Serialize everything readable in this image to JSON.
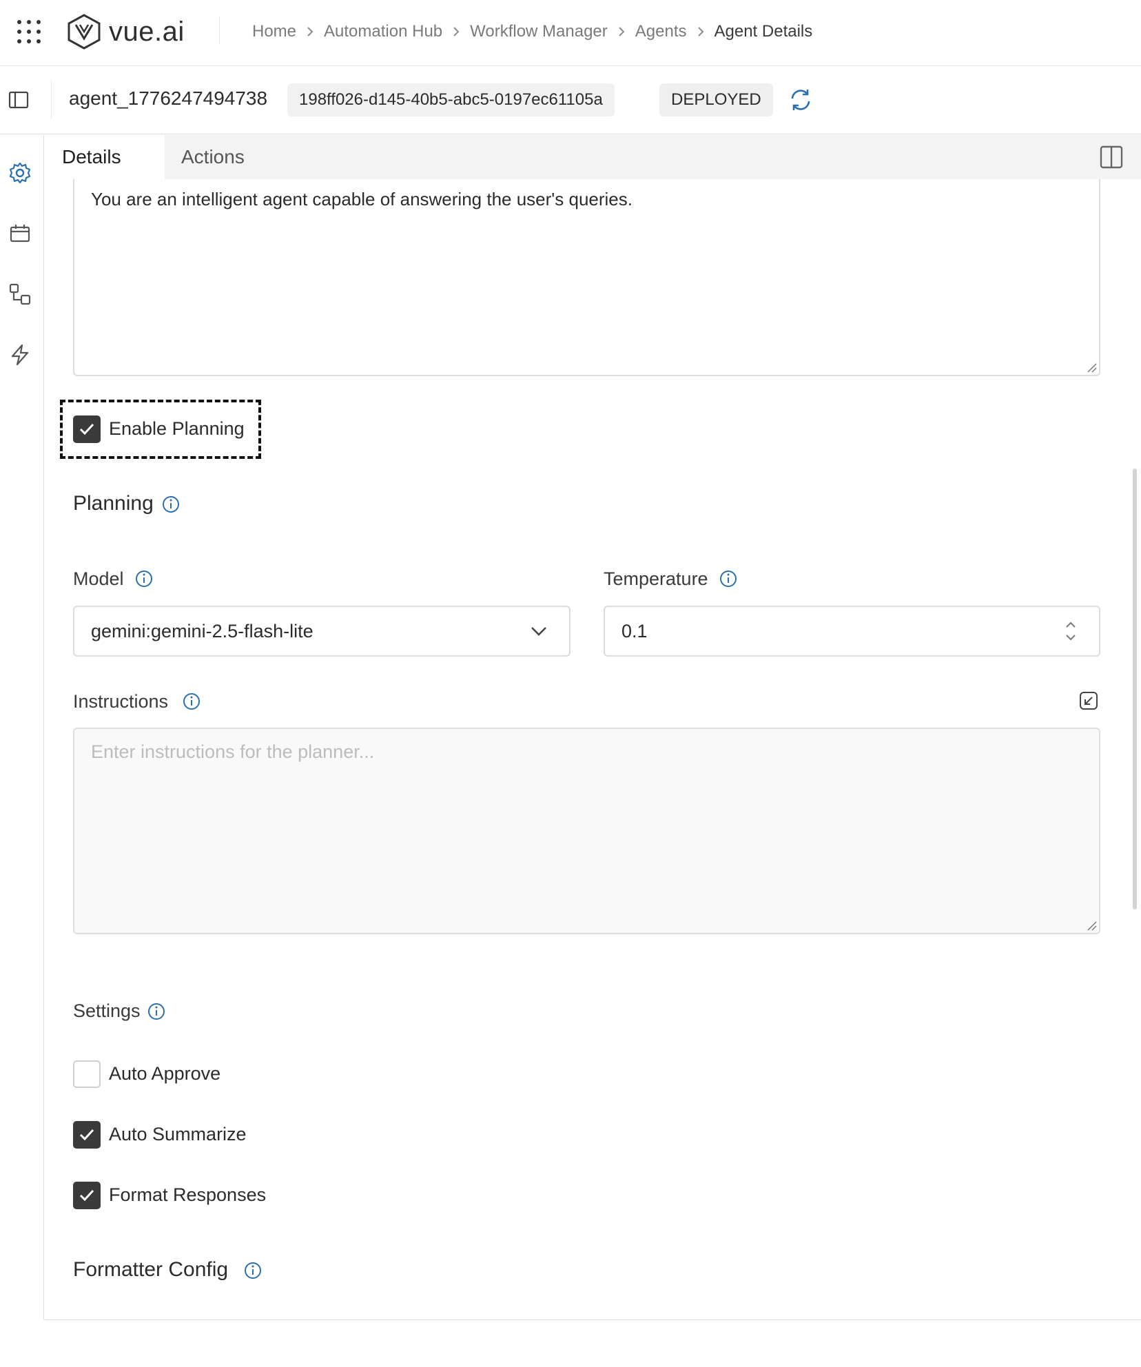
{
  "brand": {
    "name": "vue.ai"
  },
  "breadcrumb": [
    {
      "label": "Home"
    },
    {
      "label": "Automation Hub"
    },
    {
      "label": "Workflow Manager"
    },
    {
      "label": "Agents"
    },
    {
      "label": "Agent Details"
    }
  ],
  "agent": {
    "name": "agent_1776247494738",
    "id": "198ff026-d145-40b5-abc5-0197ec61105a",
    "status": "DEPLOYED"
  },
  "tabs": [
    {
      "label": "Details",
      "active": true
    },
    {
      "label": "Actions",
      "active": false
    }
  ],
  "rail_icons": [
    "settings-icon",
    "calendar-icon",
    "workflow-icon",
    "lightning-icon"
  ],
  "system_prompt": "You are an intelligent agent capable of answering the user's queries.",
  "enable_planning": {
    "label": "Enable Planning",
    "checked": true
  },
  "planning": {
    "title": "Planning",
    "model": {
      "label": "Model",
      "value": "gemini:gemini-2.5-flash-lite"
    },
    "temperature": {
      "label": "Temperature",
      "value": "0.1"
    },
    "instructions": {
      "label": "Instructions",
      "value": "",
      "placeholder": "Enter instructions for the planner..."
    }
  },
  "settings": {
    "title": "Settings",
    "options": [
      {
        "label": "Auto Approve",
        "checked": false
      },
      {
        "label": "Auto Summarize",
        "checked": true
      },
      {
        "label": "Format Responses",
        "checked": true
      }
    ]
  },
  "formatter_config": {
    "title": "Formatter Config"
  },
  "colors": {
    "accent": "#2a6fb0",
    "checkbox": "#3a3a3a",
    "border": "#dcdcdc"
  }
}
